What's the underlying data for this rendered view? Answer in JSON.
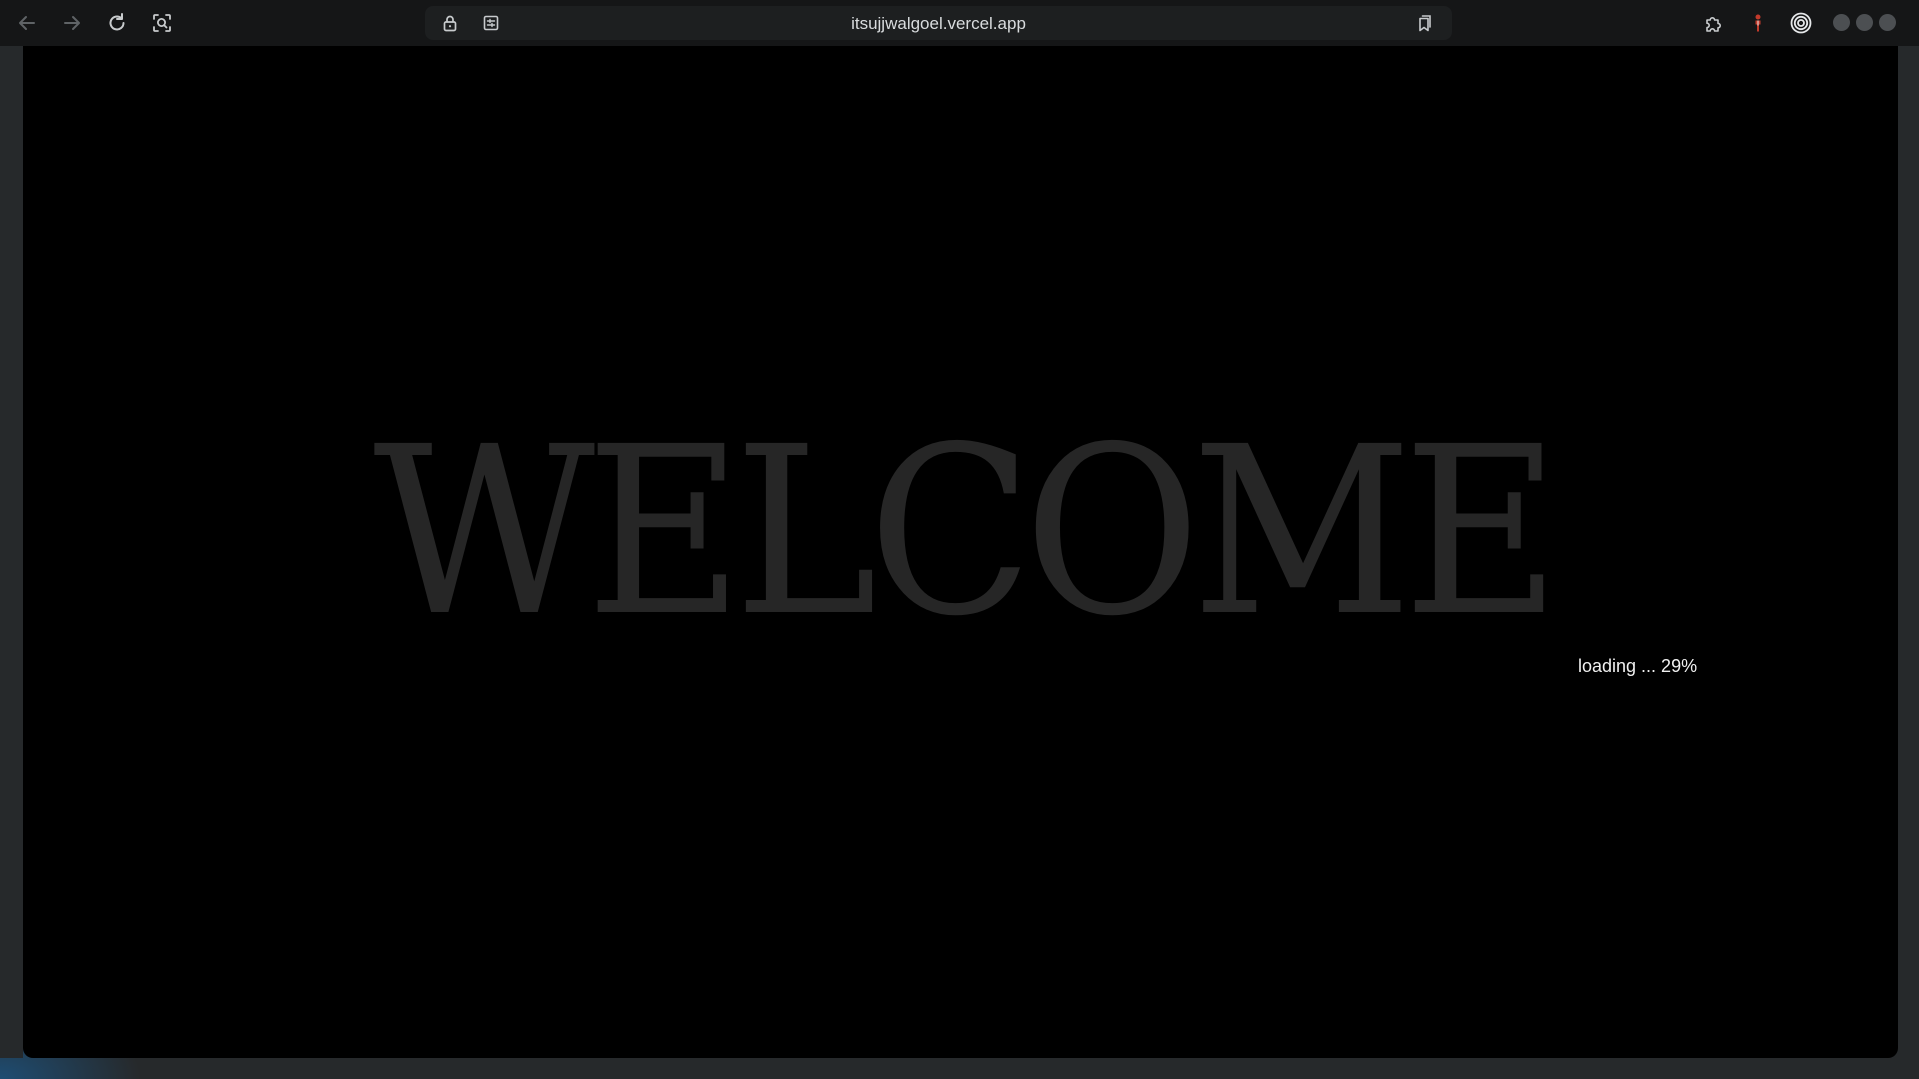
{
  "browser": {
    "url": "itsujjwalgoel.vercel.app",
    "toolbar_icons": {
      "back": "arrow-left-icon",
      "forward": "arrow-right-icon",
      "reload": "reload-icon",
      "lens": "search-lens-icon",
      "lock": "lock-icon",
      "site_settings": "site-settings-icon",
      "bookmark": "bookmark-icon",
      "extensions": "puzzle-icon",
      "profile": "profile-icon",
      "target": "target-icon"
    }
  },
  "page": {
    "headline": "WELCOME",
    "loading_text": "loading ... 29%",
    "loading_percent": 29
  },
  "colors": {
    "page_background": "#000000",
    "headline": "#262626",
    "loading_text": "#f0f0f0",
    "toolbar": "#151617"
  }
}
